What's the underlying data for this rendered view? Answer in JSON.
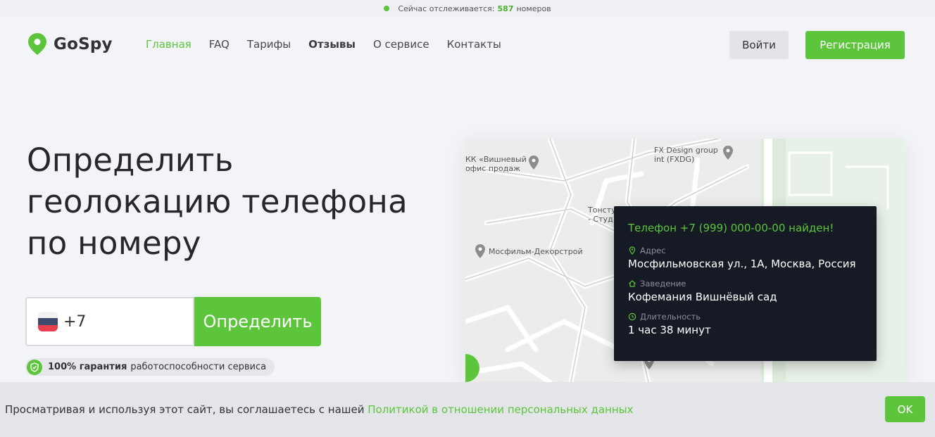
{
  "topbar": {
    "prefix": "Сейчас отслеживается:",
    "count": "587",
    "suffix": "номеров"
  },
  "header": {
    "logo_text": "GoSpy",
    "logo_icon": "location-pin-icon",
    "nav": [
      {
        "label": "Главная",
        "active": true
      },
      {
        "label": "FAQ"
      },
      {
        "label": "Тарифы"
      },
      {
        "label": "Отзывы",
        "bold": true
      },
      {
        "label": "О сервисе"
      },
      {
        "label": "Контакты"
      }
    ],
    "login_label": "Войти",
    "register_label": "Регистрация"
  },
  "hero": {
    "title_line1": "Определить",
    "title_line2": "геолокацию телефона",
    "title_line3": "по номеру",
    "phone_value": "+7",
    "detect_label": "Определить",
    "guarantee_bold": "100% гарантия",
    "guarantee_text": "работоспособности сервиса"
  },
  "map": {
    "labels": {
      "vishnevy": "КК «Вишневый\nофис продаж",
      "fx": "FX Design group\nint (FXDG)",
      "tonstu": "Тонсту\n- Студ",
      "mosfilm": "Мосфильм-Декорстрой"
    }
  },
  "info_card": {
    "title": "Телефон +7 (999) 000-00-00 найден!",
    "address_label": "Адрес",
    "address_value": "Мосфильмовская ул., 1А, Москва, Россия",
    "venue_label": "Заведение",
    "venue_value": "Кофемания Вишнёвый сад",
    "duration_label": "Длительность",
    "duration_value": "1 час 38 минут"
  },
  "cookie": {
    "text": "Просматривая и используя этот сайт, вы соглашаетесь с нашей",
    "link": "Политикой в отношении персональных данных",
    "ok_label": "OK"
  },
  "colors": {
    "accent": "#5cc53c",
    "card_bg": "#151a24",
    "page_bg": "#f3f4f7"
  }
}
